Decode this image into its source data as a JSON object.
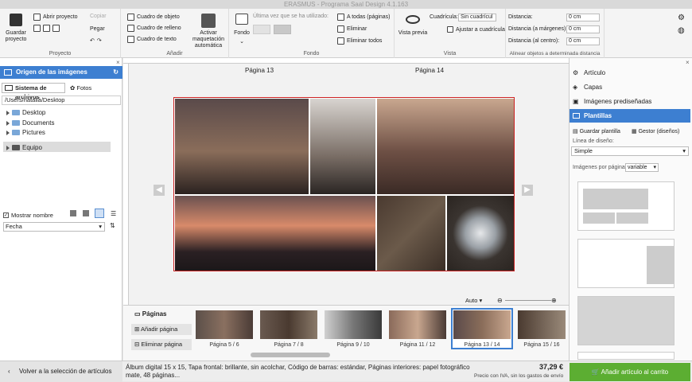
{
  "window": {
    "title": "ERASMUS - Programa Saal Design 4.1.163"
  },
  "ribbon": {
    "proyecto": {
      "label": "Proyecto",
      "save": "Guardar proyecto",
      "open": "Abrir proyecto",
      "copy": "Copiar",
      "paste": "Pegar"
    },
    "anadir": {
      "label": "Añadir",
      "object_box": "Cuadro de objeto",
      "fill_box": "Cuadro de relleno",
      "text_box": "Cuadro de texto",
      "auto_layout": "Activar maquetación automática"
    },
    "fondo": {
      "label": "Fondo",
      "fondo_btn": "Fondo",
      "last_used": "Última vez que se ha utilizado:",
      "all_pages": "A todas (páginas)",
      "delete": "Eliminar",
      "delete_all": "Eliminar todos"
    },
    "vista": {
      "label": "Vista",
      "preview": "Vista previa",
      "grid_label": "Cuadrícula:",
      "grid_value": "Sin cuadrícul",
      "snap": "Ajustar a cuadrícula"
    },
    "align": {
      "label": "Alinear objetos a determinada distancia",
      "distance": "Distancia:",
      "distance_margin": "Distancia (a márgenes):",
      "distance_center": "Distancia (al centro):",
      "value1": "0 cm",
      "value2": "0 cm",
      "value3": "0 cm"
    }
  },
  "left_panel": {
    "title": "Origen de las imágenes",
    "tab_files": "Sistema de archivos",
    "tab_photos": "Fotos",
    "path": "/Users/natalia/Desktop",
    "tree": [
      "Desktop",
      "Documents",
      "Pictures",
      "Equipo"
    ],
    "show_names": "Mostrar nombre",
    "sort_value": "Fecha"
  },
  "canvas": {
    "page_left": "Página 13",
    "page_right": "Página 14",
    "zoom": "Auto"
  },
  "right_panel": {
    "items": [
      "Artículo",
      "Capas",
      "Imágenes prediseñadas",
      "Plantillas"
    ],
    "save_template": "Guardar plantilla",
    "manager": "Gestor (diseños)",
    "design_line_label": "Línea de diseño:",
    "design_line_value": "Simple",
    "per_page_label": "Imágenes por página:",
    "per_page_value": "variable"
  },
  "filmstrip": {
    "title": "Páginas",
    "add": "Añadir página",
    "delete": "Eliminar página",
    "thumbs": [
      "Página 5 / 6",
      "Página 7 / 8",
      "Página 9 / 10",
      "Página 11 / 12",
      "Página 13 / 14",
      "Página 15 / 16"
    ]
  },
  "bottom": {
    "back": "Volver a la selección de artículos",
    "description": "Álbum digital 15 x 15, Tapa frontal: brillante, sin acolchar, Código de barras: estándar, Páginas interiores: papel fotográfico mate, 48 páginas...",
    "price": "37,29 €",
    "price_note": "Precio con IVA, sin los gastos de envío",
    "cart": "Añadir artículo al carrito"
  },
  "colors": {
    "accent_blue": "#3d7fd1",
    "cart_green": "#5cae32"
  }
}
